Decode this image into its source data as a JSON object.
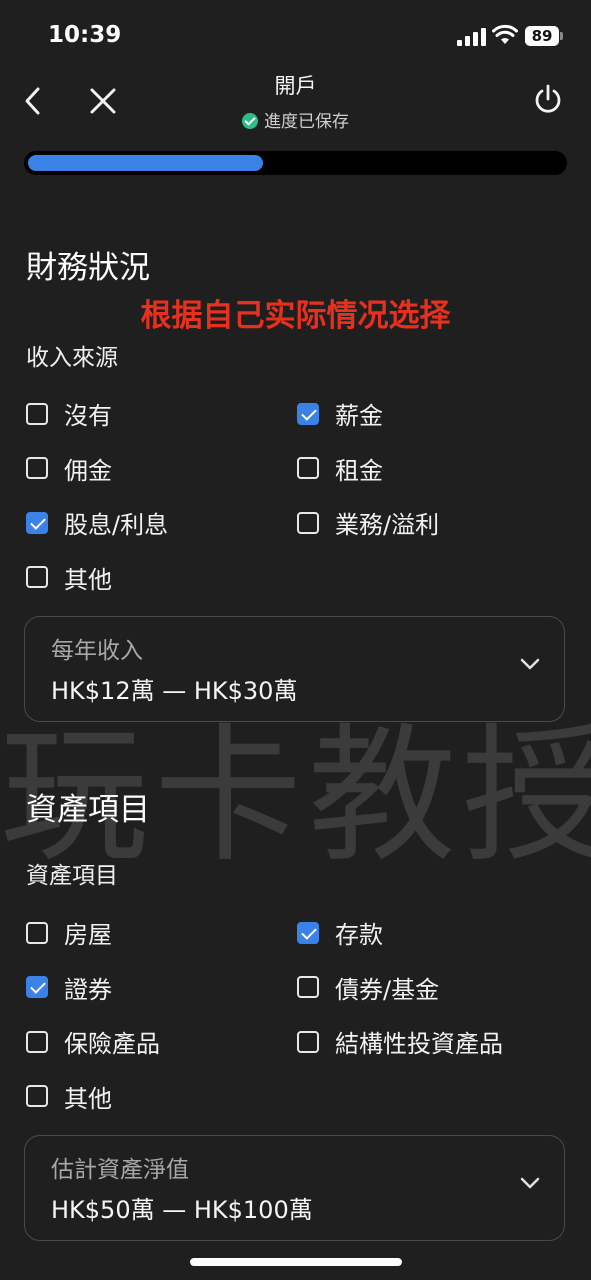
{
  "status_bar": {
    "time": "10:39",
    "battery": "89"
  },
  "header": {
    "title": "開戶",
    "saved_text": "進度已保存"
  },
  "progress": {
    "fraction": 0.44
  },
  "annotation": "根据自己实际情况选择",
  "watermark": "玩卡教授",
  "financial": {
    "section_title": "財務狀況",
    "income_label": "收入來源",
    "income_options": [
      {
        "label": "沒有",
        "checked": false
      },
      {
        "label": "薪金",
        "checked": true
      },
      {
        "label": "佣金",
        "checked": false
      },
      {
        "label": "租金",
        "checked": false
      },
      {
        "label": "股息/利息",
        "checked": true
      },
      {
        "label": "業務/溢利",
        "checked": false
      },
      {
        "label": "其他",
        "checked": false
      }
    ],
    "annual_income": {
      "label": "每年收入",
      "value": "HK$12萬 — HK$30萬"
    }
  },
  "assets": {
    "section_title": "資產項目",
    "assets_label": "資產項目",
    "asset_options": [
      {
        "label": "房屋",
        "checked": false
      },
      {
        "label": "存款",
        "checked": true
      },
      {
        "label": "證券",
        "checked": true
      },
      {
        "label": "債券/基金",
        "checked": false
      },
      {
        "label": "保險產品",
        "checked": false
      },
      {
        "label": "結構性投資產品",
        "checked": false
      },
      {
        "label": "其他",
        "checked": false
      }
    ],
    "net_worth": {
      "label": "估計資產淨值",
      "value": "HK$50萬 — HK$100萬"
    }
  },
  "colors": {
    "accent": "#3b82e8",
    "background": "#1f1f1f",
    "saved_green": "#2ebd85",
    "annotation_red": "#e8301e"
  }
}
